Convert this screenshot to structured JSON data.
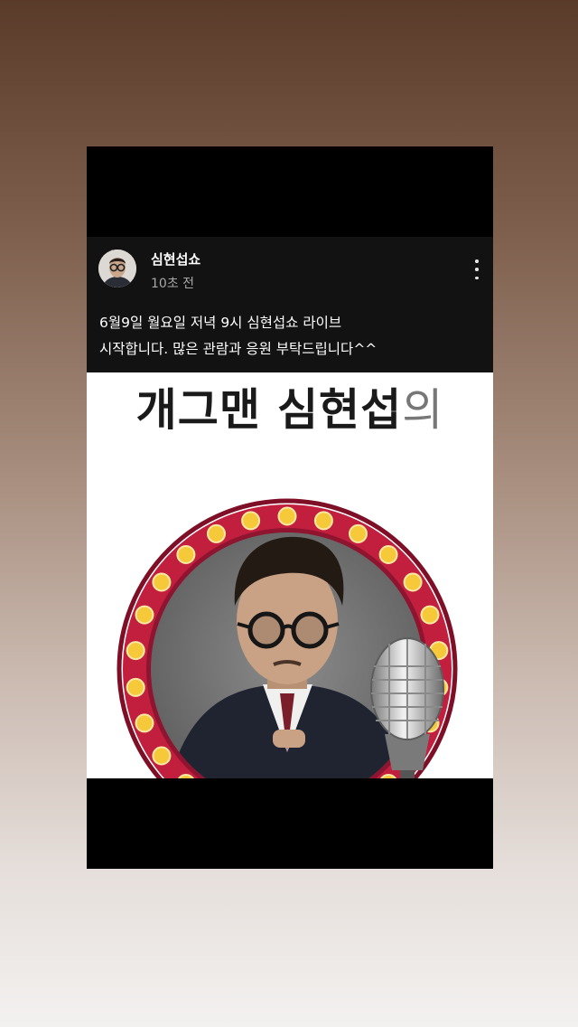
{
  "post": {
    "author": "심현섭쇼",
    "time": "10초 전",
    "caption_line1": "6월9일 월요일 저녁 9시 심현섭쇼 라이브",
    "caption_line2": "시작합니다. 많은 관람과 응원 부탁드립니다^^"
  },
  "poster": {
    "title_main": "개그맨 심현섭",
    "title_suffix": "의"
  },
  "colors": {
    "ring": "#c21f3f",
    "bulb": "#f6c93a",
    "header_bg": "#121212"
  }
}
